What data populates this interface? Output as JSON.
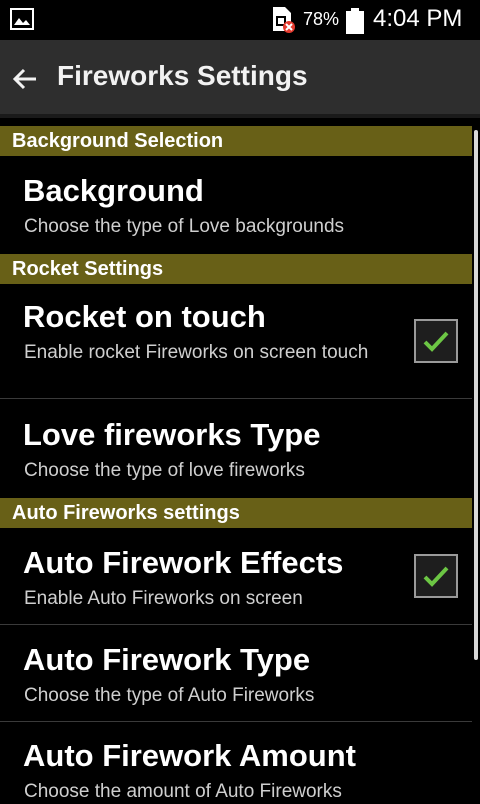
{
  "status_bar": {
    "battery": "78%",
    "time": "4:04 PM",
    "icons": [
      "gallery-icon",
      "no-sim-icon",
      "battery-icon"
    ]
  },
  "action_bar": {
    "title": "Fireworks Settings",
    "back_icon": "back-arrow-icon"
  },
  "sections": [
    {
      "header": "Background Selection",
      "items": [
        {
          "title": "Background",
          "summary": "Choose the type of Love backgrounds"
        }
      ]
    },
    {
      "header": "Rocket Settings",
      "items": [
        {
          "title": "Rocket on touch",
          "summary": "Enable rocket Fireworks on screen touch",
          "checked": true
        },
        {
          "title": "Love fireworks Type",
          "summary": "Choose the type of love fireworks"
        }
      ]
    },
    {
      "header": "Auto Fireworks settings",
      "items": [
        {
          "title": "Auto Firework Effects",
          "summary": "Enable Auto Fireworks on screen",
          "checked": true
        },
        {
          "title": "Auto Firework Type",
          "summary": "Choose the type of Auto Fireworks"
        },
        {
          "title": "Auto Firework Amount",
          "summary": "Choose the amount of Auto Fireworks"
        }
      ]
    }
  ],
  "colors": {
    "section_header_bg": "#686017",
    "action_bar_bg": "#2e2e2e",
    "check_mark": "#6cc644"
  }
}
